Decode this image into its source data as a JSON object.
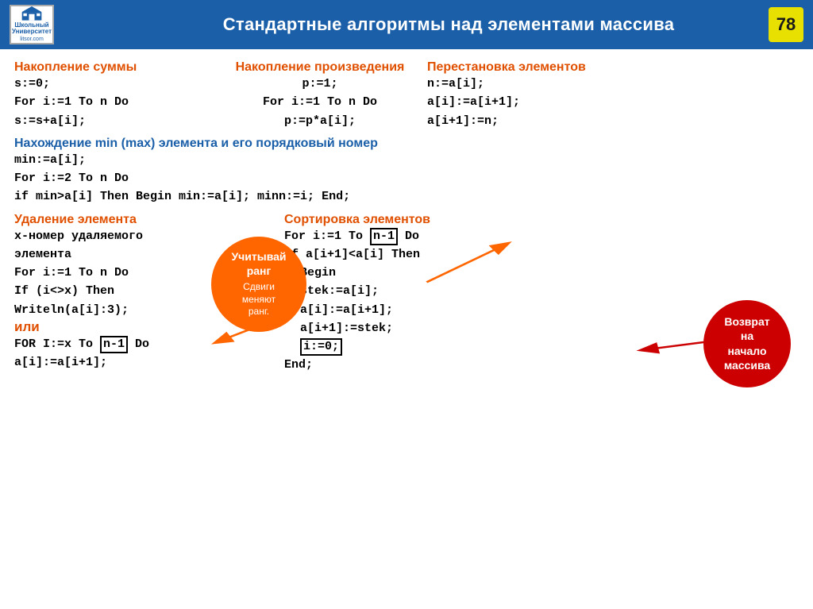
{
  "header": {
    "logo_line1": "Школьный",
    "logo_line2": "Университет",
    "logo_url_text": "litsor.com",
    "title": "Стандартные алгоритмы над элементами массива",
    "page_number": "78"
  },
  "sections": {
    "sum_title": "Накопление суммы",
    "sum_code": [
      "s:=0;",
      "For i:=1 To n Do",
      "  s:=s+a[i];"
    ],
    "prod_title": "Накопление произведения",
    "prod_code": [
      "p:=1;",
      "For i:=1 To n Do",
      "  p:=p*a[i];"
    ],
    "swap_title": "Перестановка элементов",
    "swap_code": [
      "n:=a[i];",
      "a[i]:=a[i+1];",
      "a[i+1]:=n;"
    ],
    "minmax_title": "Нахождение  min (max) элемента и его порядковый номер",
    "minmax_code": [
      "min:=a[i];",
      "For i:=2 To n Do",
      "  if  min>a[i] Then Begin min:=a[i]; minn:=i; End;"
    ],
    "delete_title": "Удаление элемента",
    "delete_code": [
      "x-номер  удаляемого",
      "элемента",
      "For i:=1 To n Do",
      "  If (i<>x) Then",
      "    Writeln(a[i]:3);"
    ],
    "ili": "или",
    "delete_code2": [
      "FOR I:=x To n-1 Do",
      "  a[i]:=a[i+1];"
    ],
    "sort_title": "Сортировка элементов",
    "sort_code": [
      "For i:=1 To n-1 Do",
      "  If a[i+1]<a[i] Then",
      "    Begin",
      "      stek:=a[i];",
      "      a[i]:=a[i+1];",
      "      a[i+1]:=stek;",
      "    i:=0;",
      "    End;"
    ],
    "callout_orange_line1": "Учитывай",
    "callout_orange_line2": "ранг",
    "callout_orange_line3": "Сдвиги",
    "callout_orange_line4": "меняют",
    "callout_orange_line5": "ранг.",
    "callout_red_line1": "Возврат",
    "callout_red_line2": "на",
    "callout_red_line3": "начало",
    "callout_red_line4": "массива"
  }
}
